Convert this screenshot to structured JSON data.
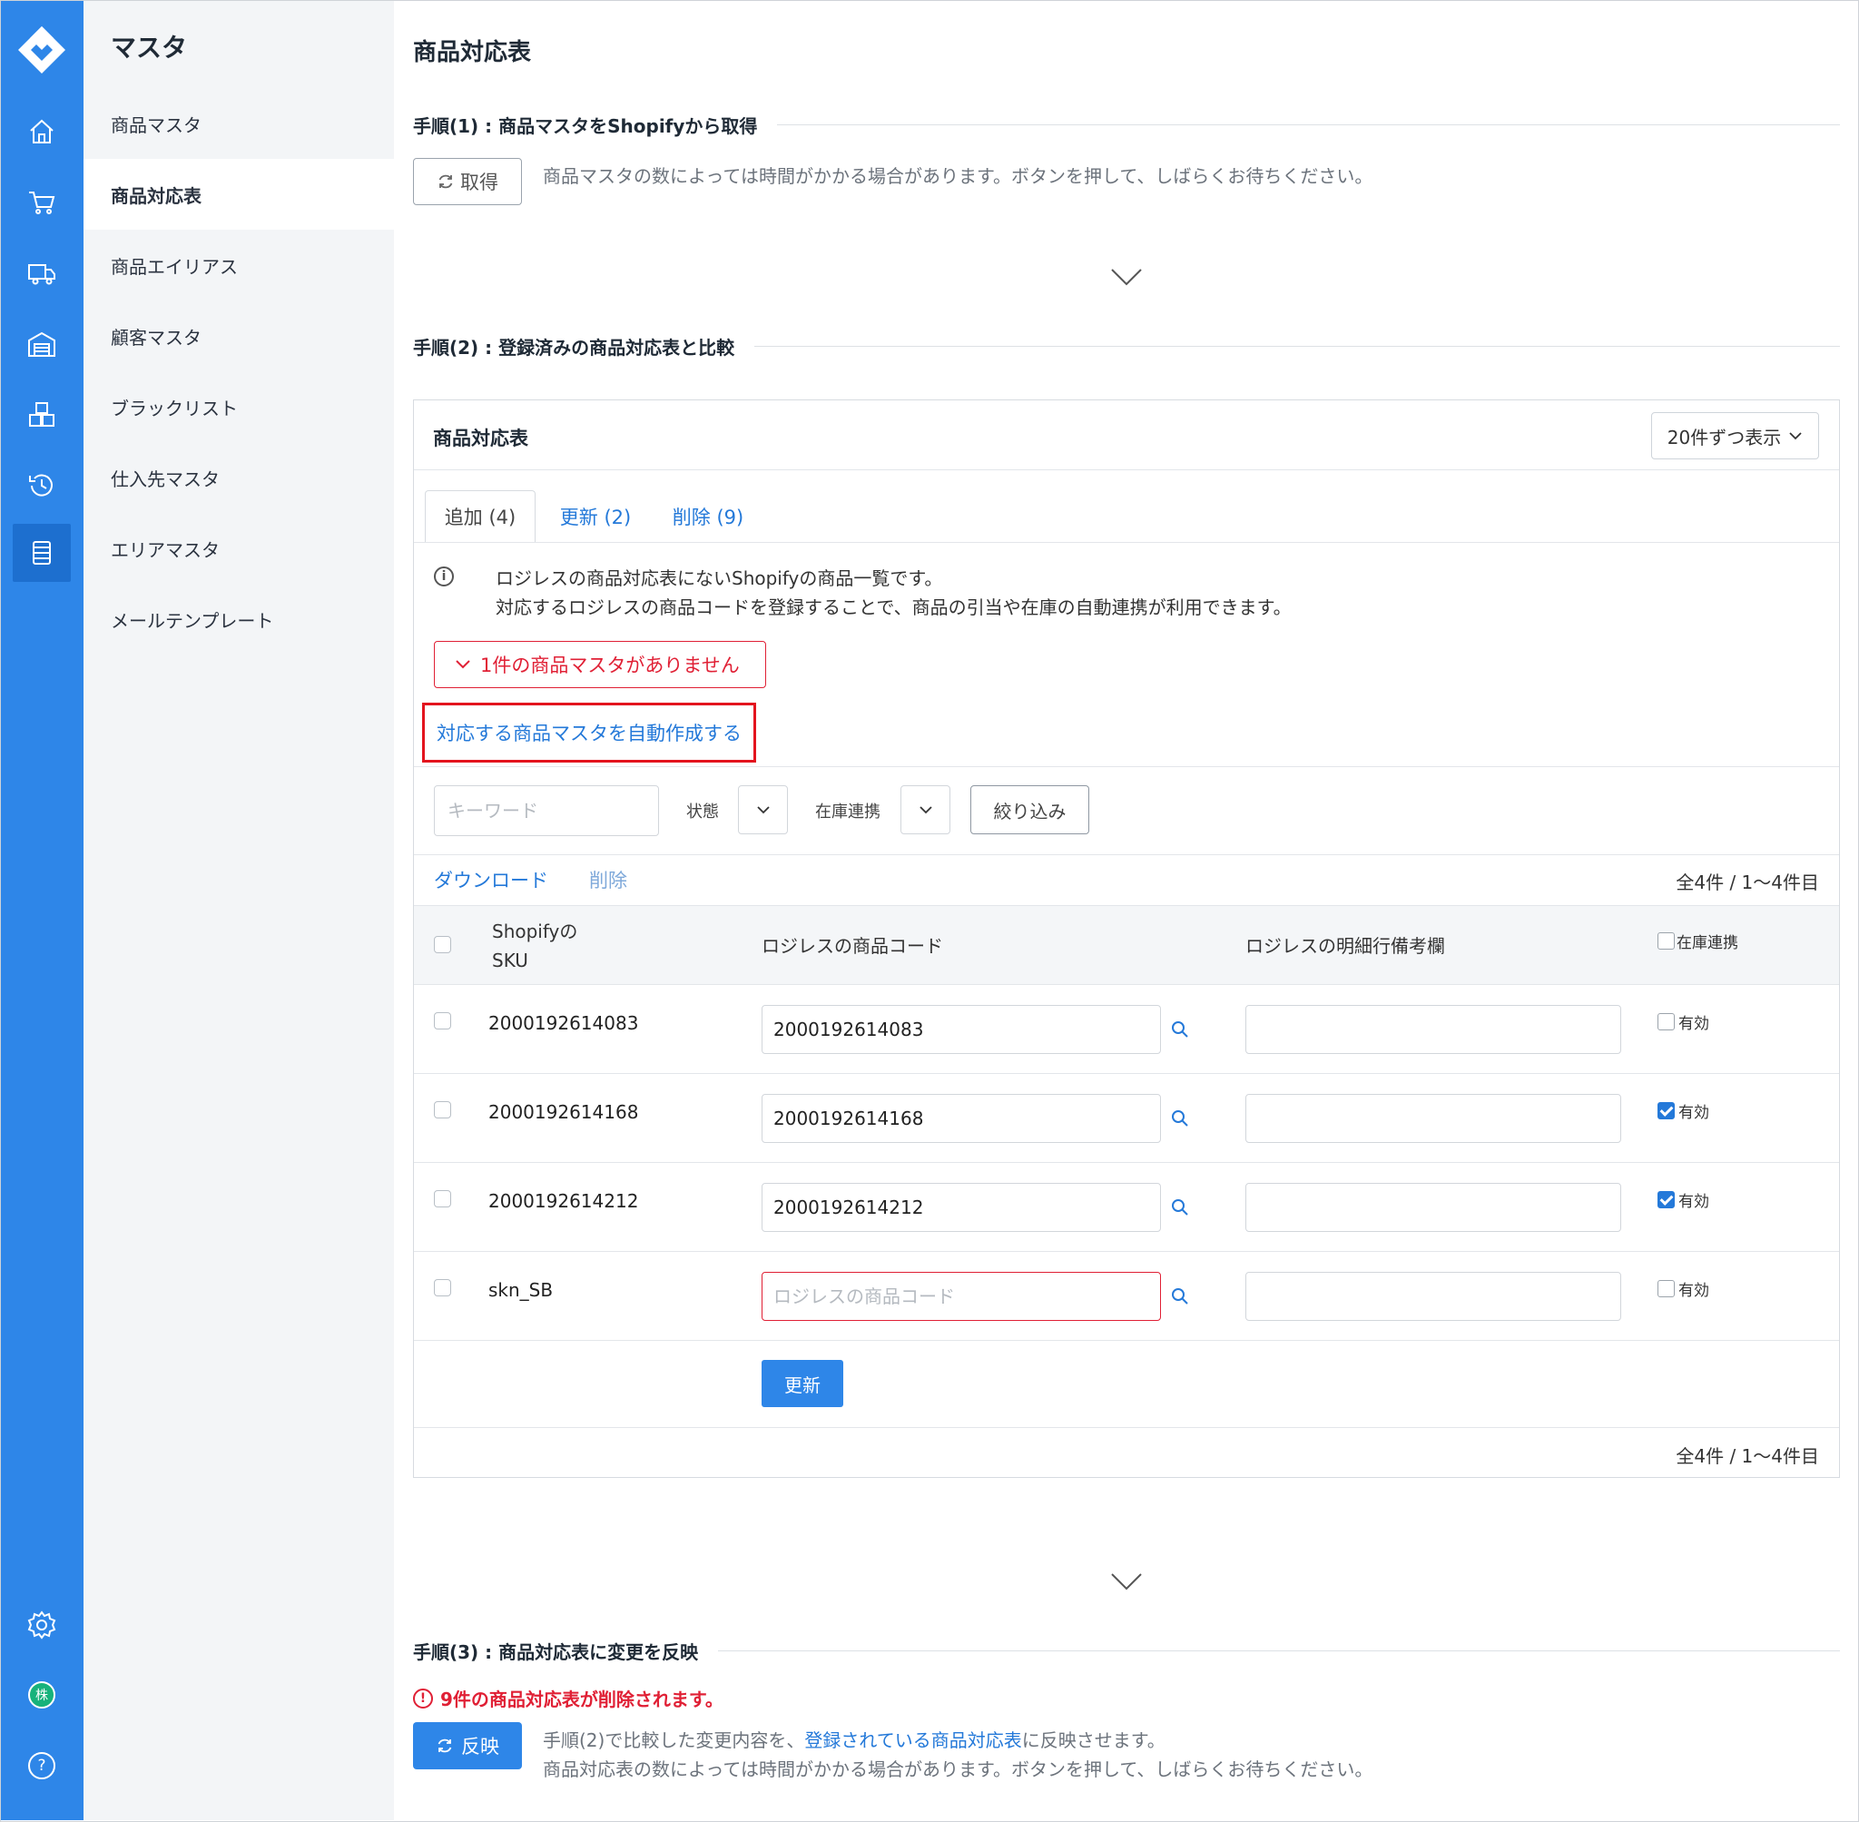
{
  "sidebar": {
    "title": "マスタ",
    "items": [
      {
        "label": "商品マスタ"
      },
      {
        "label": "商品対応表"
      },
      {
        "label": "商品エイリアス"
      },
      {
        "label": "顧客マスタ"
      },
      {
        "label": "ブラックリスト"
      },
      {
        "label": "仕入先マスタ"
      },
      {
        "label": "エリアマスタ"
      },
      {
        "label": "メールテンプレート"
      }
    ],
    "rail_icons": [
      "home-icon",
      "cart-icon",
      "truck-icon",
      "warehouse-icon",
      "boxes-icon",
      "history-icon",
      "master-icon",
      "settings-icon",
      "company-icon",
      "help-icon"
    ],
    "company_badge": "株",
    "help_glyph": "?"
  },
  "page": {
    "title": "商品対応表"
  },
  "step1": {
    "heading": "手順(1) : 商品マスタをShopifyから取得",
    "button": "取得",
    "note": "商品マスタの数によっては時間がかかる場合があります。ボタンを押して、しばらくお待ちください。"
  },
  "step2": {
    "heading": "手順(2) : 登録済みの商品対応表と比較",
    "card_title": "商品対応表",
    "per_page": "20件ずつ表示",
    "tabs": [
      {
        "label": "追加 (4)"
      },
      {
        "label": "更新 (2)"
      },
      {
        "label": "削除 (9)"
      }
    ],
    "info_line1": "ロジレスの商品対応表にないShopifyの商品一覧です。",
    "info_line2": "対応するロジレスの商品コードを登録することで、商品の引当や在庫の自動連携が利用できます。",
    "warning": "1件の商品マスタがありません",
    "auto_create": "対応する商品マスタを自動作成する",
    "filter": {
      "keyword_placeholder": "キーワード",
      "status_label": "状態",
      "stock_label": "在庫連携",
      "filter_button": "絞り込み"
    },
    "actions": {
      "download": "ダウンロード",
      "delete": "削除"
    },
    "count": "全4件 / 1〜4件目",
    "columns": {
      "sku_line1": "Shopifyの",
      "sku_line2": "SKU",
      "code": "ロジレスの商品コード",
      "memo": "ロジレスの明細行備考欄",
      "stock": "在庫連携"
    },
    "rows": [
      {
        "sku": "2000192614083",
        "code": "2000192614083",
        "valid_label": "有効",
        "checked": false
      },
      {
        "sku": "2000192614168",
        "code": "2000192614168",
        "valid_label": "有効",
        "checked": true
      },
      {
        "sku": "2000192614212",
        "code": "2000192614212",
        "valid_label": "有効",
        "checked": true
      },
      {
        "sku": "skn_SB",
        "code": "",
        "code_placeholder": "ロジレスの商品コード",
        "valid_label": "有効",
        "checked": false
      }
    ],
    "update_button": "更新"
  },
  "step3": {
    "heading": "手順(3) : 商品対応表に変更を反映",
    "alert": "9件の商品対応表が削除されます。",
    "alert_glyph": "!",
    "button": "反映",
    "desc_prefix": "手順(2)で比較した変更内容を、",
    "desc_link": "登録されている商品対応表",
    "desc_suffix": "に反映させます。",
    "desc_line2": "商品対応表の数によっては時間がかかる場合があります。ボタンを押して、しばらくお待ちください。"
  },
  "colors": {
    "primary": "#2e86e8",
    "danger": "#e02035",
    "link": "#2479d9"
  }
}
